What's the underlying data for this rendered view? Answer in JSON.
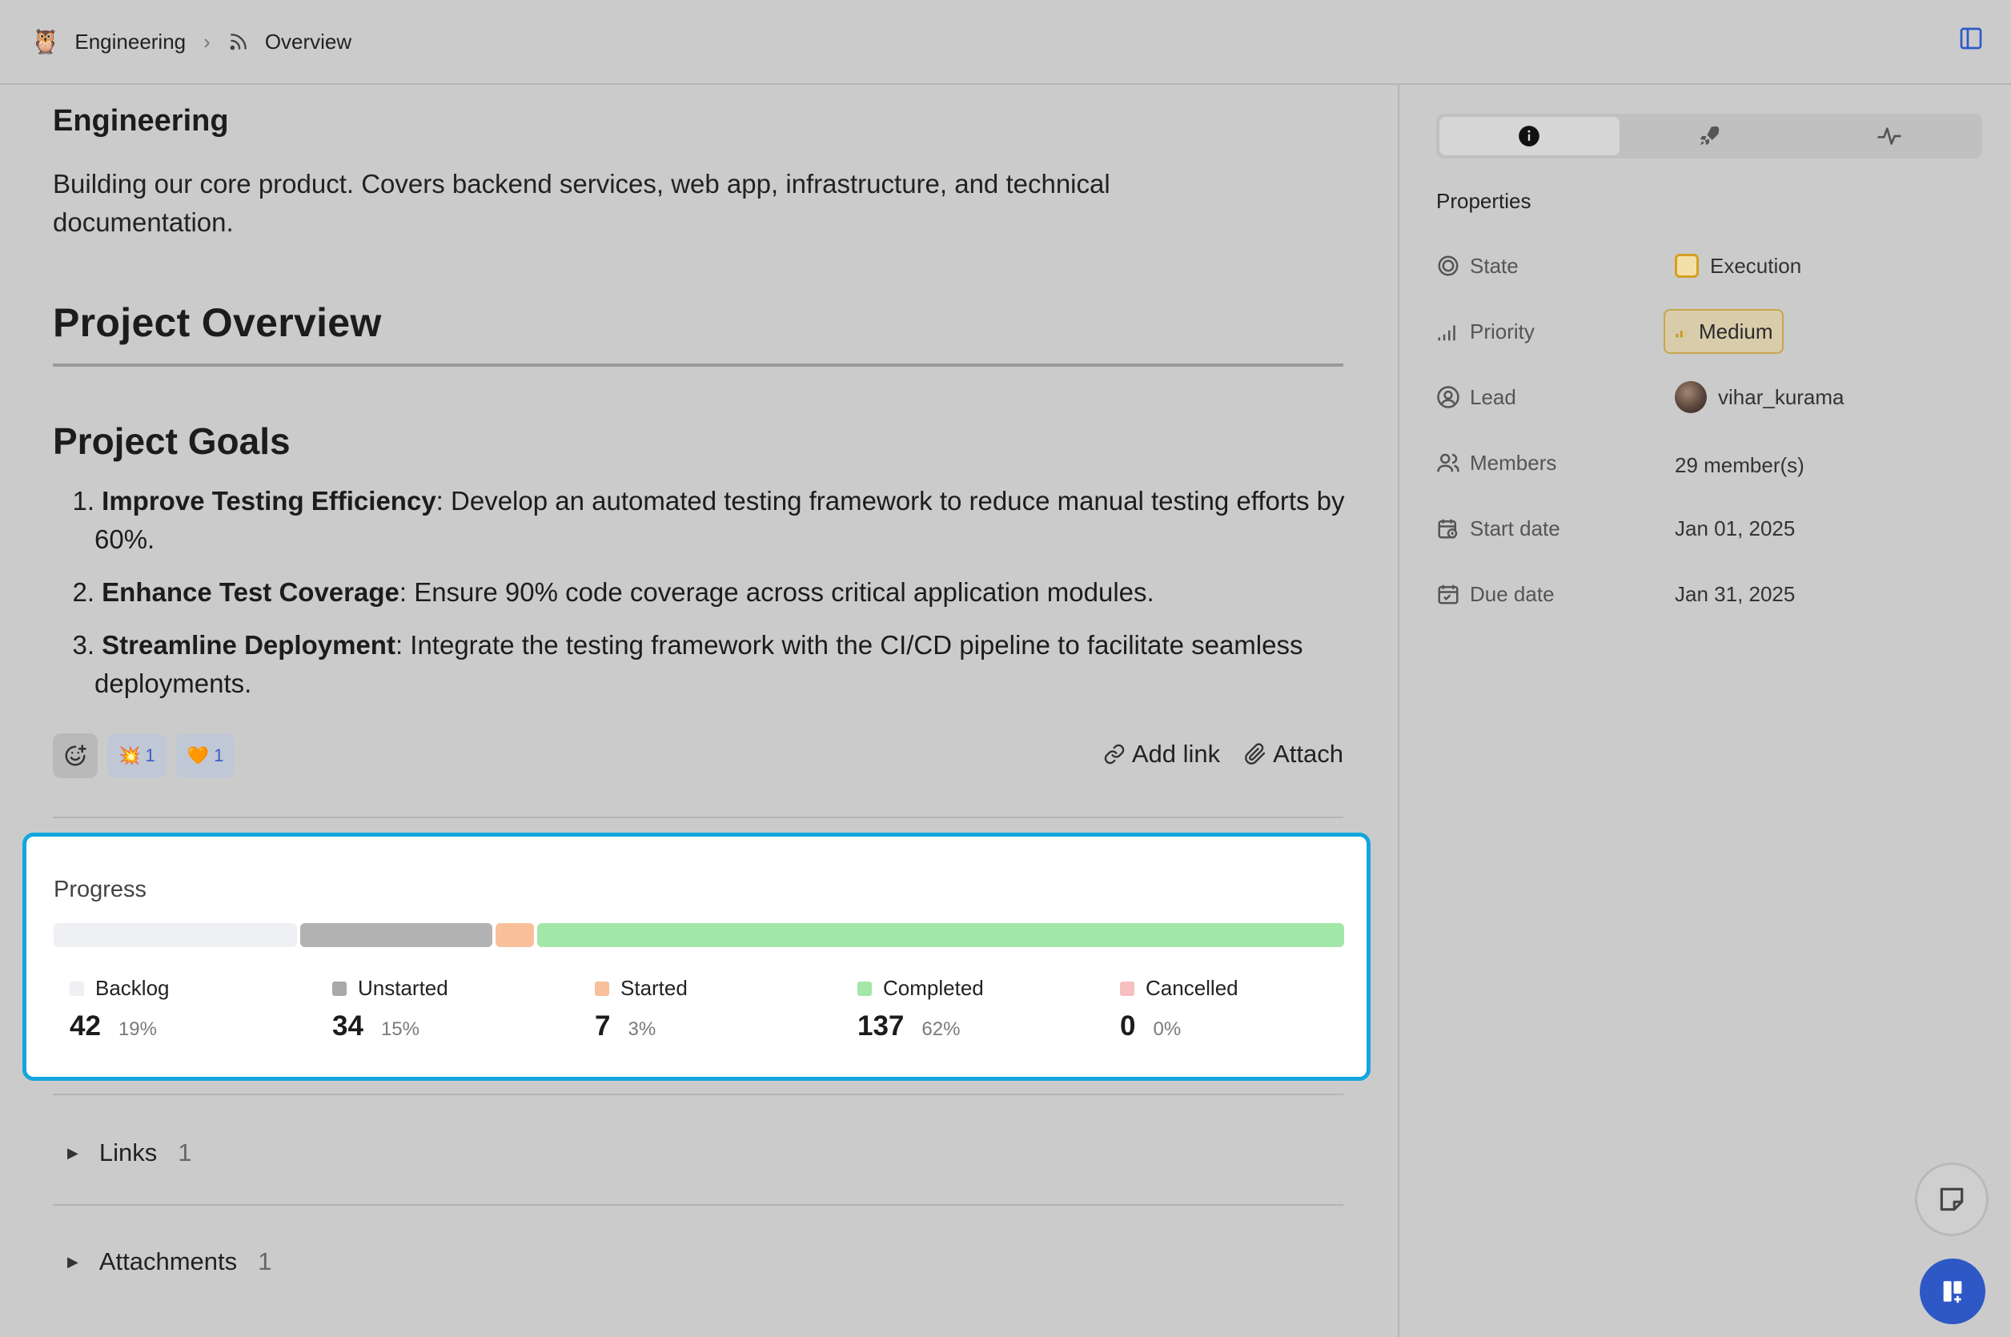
{
  "breadcrumb": {
    "project": "Engineering",
    "page": "Overview"
  },
  "main": {
    "project_name": "Engineering",
    "project_description": "Building our core product. Covers backend services, web app, infrastructure, and technical documentation.",
    "overview_heading": "Project Overview",
    "goals_heading": "Project Goals",
    "goals": [
      {
        "num": "1.",
        "title": "Improve Testing Efficiency",
        "text": ": Develop an automated testing framework to reduce manual testing efforts by 60%."
      },
      {
        "num": "2.",
        "title": "Enhance Test Coverage",
        "text": ": Ensure 90% code coverage across critical application modules."
      },
      {
        "num": "3.",
        "title": "Streamline Deployment",
        "text": ": Integrate the testing framework with the CI/CD pipeline to facilitate seamless deployments."
      }
    ],
    "reactions": [
      {
        "emoji": "💥",
        "count": "1"
      },
      {
        "emoji": "🧡",
        "count": "1"
      }
    ],
    "add_link_label": "Add link",
    "attach_label": "Attach"
  },
  "progress": {
    "title": "Progress",
    "states": [
      {
        "name": "Backlog",
        "count": "42",
        "percent": "19%",
        "fraction": 0.19,
        "color": "#eef0f3"
      },
      {
        "name": "Unstarted",
        "count": "34",
        "percent": "15%",
        "fraction": 0.15,
        "color": "#b2b2b2"
      },
      {
        "name": "Started",
        "count": "7",
        "percent": "3%",
        "fraction": 0.03,
        "color": "#f8c09a"
      },
      {
        "name": "Completed",
        "count": "137",
        "percent": "62%",
        "fraction": 0.62,
        "color": "#a3e7a8"
      },
      {
        "name": "Cancelled",
        "count": "0",
        "percent": "0%",
        "fraction": 0.0,
        "color": "#f7bfbf"
      }
    ]
  },
  "sections": {
    "links_label": "Links",
    "links_count": "1",
    "attachments_label": "Attachments",
    "attachments_count": "1"
  },
  "panel": {
    "properties_title": "Properties",
    "state_label": "State",
    "state_value": "Execution",
    "priority_label": "Priority",
    "priority_value": "Medium",
    "lead_label": "Lead",
    "lead_value": "vihar_kurama",
    "members_label": "Members",
    "members_value": "29 member(s)",
    "start_label": "Start date",
    "start_value": "Jan 01, 2025",
    "due_label": "Due date",
    "due_value": "Jan 31, 2025"
  },
  "icons": {
    "project": "owl-emoji-icon",
    "page": "rss-feed-icon",
    "sidebar_toggle": "panel-toggle-icon",
    "tab_info": "info-icon",
    "tab_updates": "rocket-icon",
    "tab_activity": "activity-pulse-icon"
  }
}
